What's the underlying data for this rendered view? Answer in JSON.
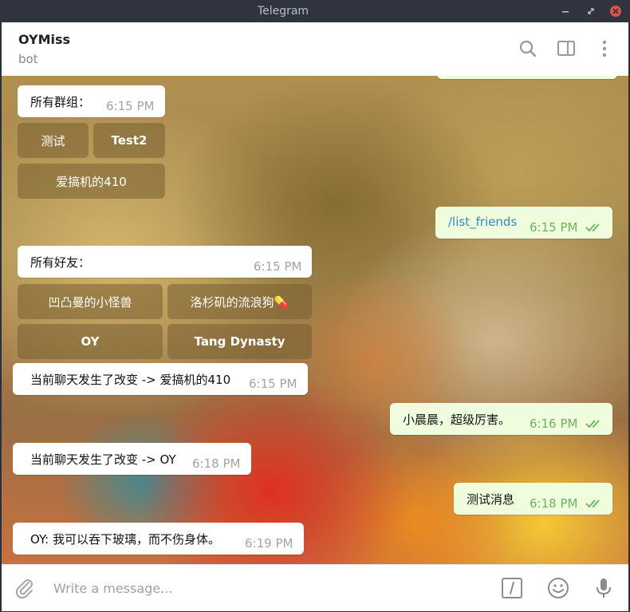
{
  "window": {
    "title": "Telegram"
  },
  "header": {
    "name": "OYMiss",
    "status": "bot"
  },
  "messages": [
    {
      "text": "所有群组：",
      "time": "6:15 PM"
    },
    {
      "text": "/list_friends",
      "time": "6:15 PM"
    },
    {
      "text": "所有好友：",
      "time": "6:15 PM"
    },
    {
      "text": "当前聊天发生了改变 -> 爱搞机的410",
      "time": "6:15 PM"
    },
    {
      "text": "小晨晨，超级厉害。",
      "time": "6:16 PM"
    },
    {
      "text": "当前聊天发生了改变 -> OY",
      "time": "6:18 PM"
    },
    {
      "text": "测试消息",
      "time": "6:18 PM"
    },
    {
      "text": "OY: 我可以吞下玻璃，而不伤身体。",
      "time": "6:19 PM"
    }
  ],
  "group_buttons": [
    "测试",
    "Test2",
    "爱搞机的410"
  ],
  "friend_buttons": [
    "凹凸曼的小怪兽",
    "洛杉矶的流浪狗💊",
    "OY",
    "Tang Dynasty"
  ],
  "compose": {
    "placeholder": "Write a message..."
  },
  "colors": {
    "outgoing_bubble": "#effdde",
    "incoming_bubble": "#ffffff",
    "time_outgoing": "#6cb45c",
    "link": "#2a8ec0",
    "titlebar": "#2f343f",
    "close_button": "#e0544d"
  },
  "icons": [
    "minimize-icon",
    "maximize-icon",
    "close-icon",
    "search-icon",
    "sidebar-toggle-icon",
    "more-vertical-icon",
    "attach-icon",
    "bot-command-icon",
    "emoji-icon",
    "microphone-icon",
    "double-check-icon"
  ]
}
